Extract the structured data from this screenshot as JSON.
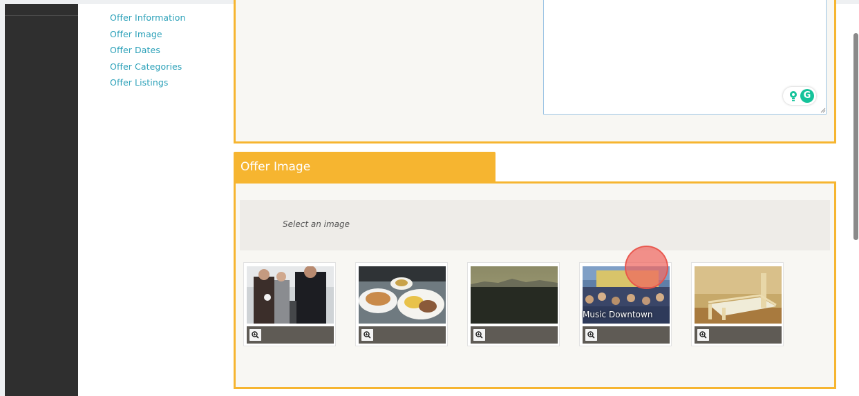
{
  "nav": {
    "items": [
      {
        "label": "Offer Information"
      },
      {
        "label": "Offer Image"
      },
      {
        "label": "Offer Dates"
      },
      {
        "label": "Offer Categories"
      },
      {
        "label": "Offer Listings"
      }
    ]
  },
  "offer_image": {
    "heading": "Offer Image",
    "select_prompt": "Select an image",
    "images": [
      {
        "subject": "people in suits at event",
        "caption": "",
        "zoom_icon": "zoom-in-icon"
      },
      {
        "subject": "plates of food",
        "caption": "",
        "zoom_icon": "zoom-in-icon"
      },
      {
        "subject": "dusky city skyline",
        "caption": "",
        "zoom_icon": "zoom-in-icon"
      },
      {
        "subject": "crowd at outdoor concert",
        "caption": "Music Downtown",
        "zoom_icon": "zoom-in-icon"
      },
      {
        "subject": "wooden bed frame in room",
        "caption": "",
        "zoom_icon": "zoom-in-icon"
      }
    ]
  },
  "grammarly": {
    "icons": [
      "lightbulb-icon",
      "grammarly-icon"
    ]
  },
  "colors": {
    "accent": "#f6b530",
    "link": "#2aa0b8",
    "panel_bg": "#f8f7f3",
    "sidebar_dark": "#2f2f2f"
  }
}
